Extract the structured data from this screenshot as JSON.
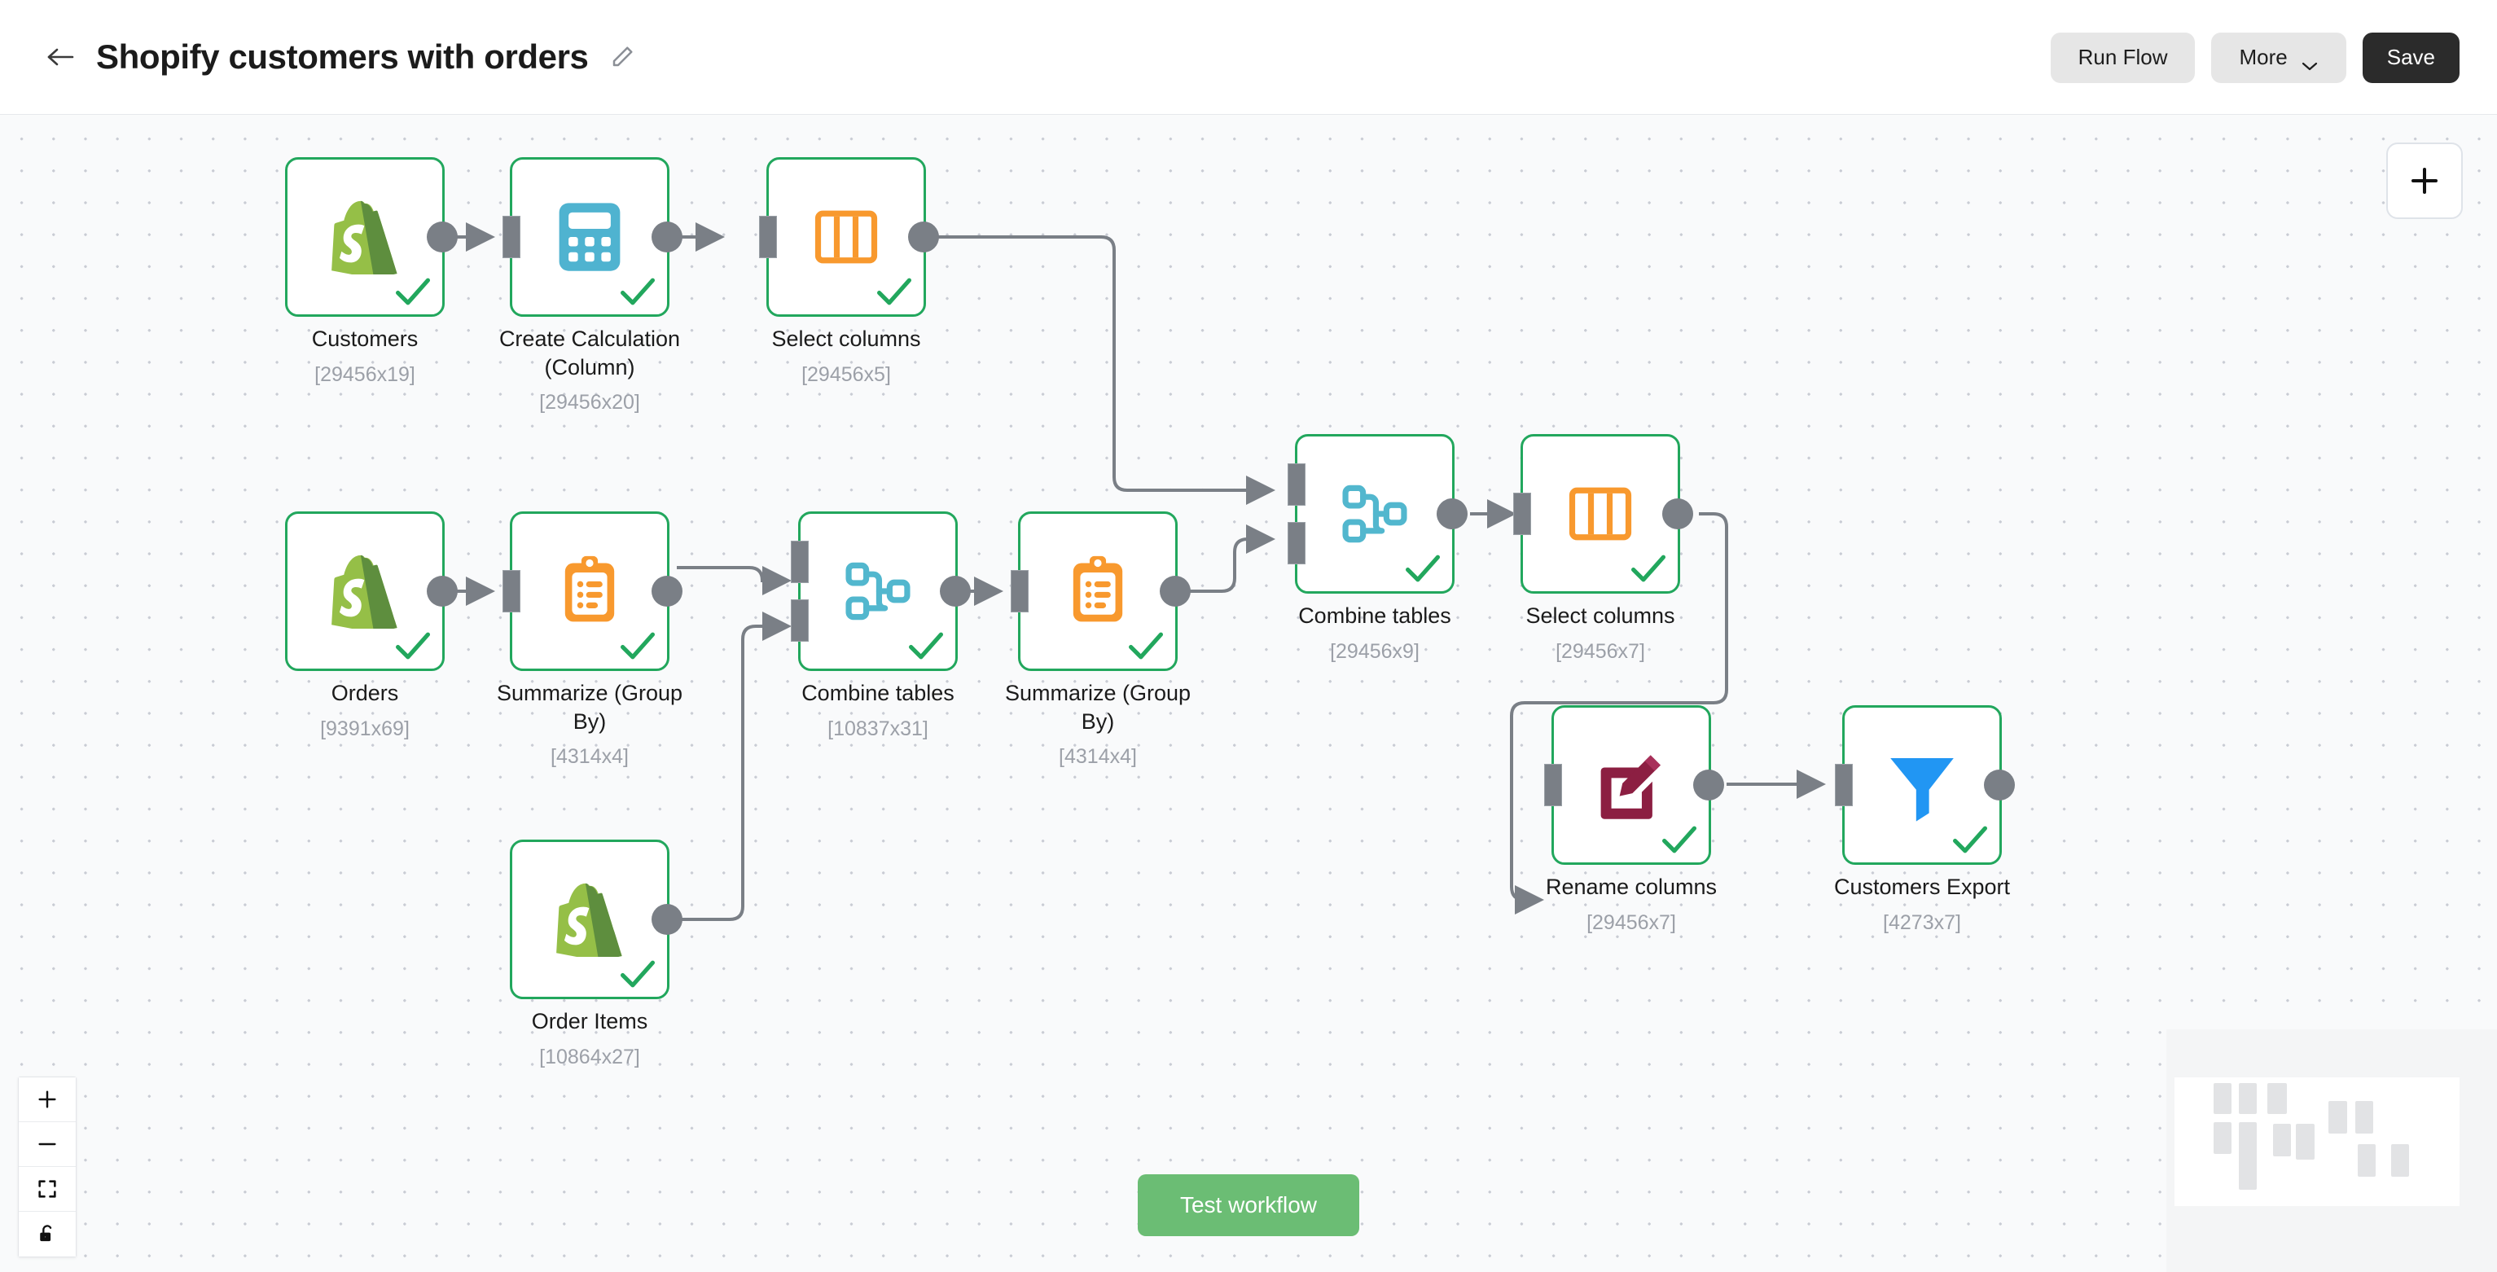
{
  "header": {
    "back_icon": "arrow-left-icon",
    "title": "Shopify customers with orders",
    "edit_icon": "pencil-icon",
    "run_flow_label": "Run Flow",
    "more_label": "More",
    "more_chevron_icon": "chevron-down-icon",
    "save_label": "Save"
  },
  "canvas": {
    "add_node_icon": "plus-icon",
    "test_workflow_label": "Test workflow",
    "zoom_controls": [
      {
        "name": "zoom-in",
        "icon": "plus-icon"
      },
      {
        "name": "zoom-out",
        "icon": "minus-icon"
      },
      {
        "name": "fit-view",
        "icon": "fit-screen-icon"
      },
      {
        "name": "lock-toggle",
        "icon": "unlock-icon"
      }
    ]
  },
  "nodes": [
    {
      "id": "customers",
      "title": "Customers",
      "sub": "[29456x19]",
      "icon": "shopify-icon",
      "status": "success"
    },
    {
      "id": "create-calc",
      "title": "Create Calculation\n(Column)",
      "sub": "[29456x20]",
      "icon": "calculator-icon",
      "status": "success"
    },
    {
      "id": "select-cols-1",
      "title": "Select columns",
      "sub": "[29456x5]",
      "icon": "columns-icon",
      "status": "success"
    },
    {
      "id": "orders",
      "title": "Orders",
      "sub": "[9391x69]",
      "icon": "shopify-icon",
      "status": "success"
    },
    {
      "id": "summarize-1",
      "title": "Summarize (Group\nBy)",
      "sub": "[4314x4]",
      "icon": "clipboard-list-icon",
      "status": "success"
    },
    {
      "id": "combine-2",
      "title": "Combine tables",
      "sub": "[10837x31]",
      "icon": "merge-icon",
      "status": "success"
    },
    {
      "id": "summarize-2",
      "title": "Summarize (Group\nBy)",
      "sub": "[4314x4]",
      "icon": "clipboard-list-icon",
      "status": "success"
    },
    {
      "id": "order-items",
      "title": "Order Items",
      "sub": "[10864x27]",
      "icon": "shopify-icon",
      "status": "success"
    },
    {
      "id": "combine-1",
      "title": "Combine tables",
      "sub": "[29456x9]",
      "icon": "merge-icon",
      "status": "success"
    },
    {
      "id": "select-cols-2",
      "title": "Select columns",
      "sub": "[29456x7]",
      "icon": "columns-icon",
      "status": "success"
    },
    {
      "id": "rename-cols",
      "title": "Rename columns",
      "sub": "[29456x7]",
      "icon": "edit-square-icon",
      "status": "success"
    },
    {
      "id": "customers-export",
      "title": "Customers Export",
      "sub": "[4273x7]",
      "icon": "funnel-icon",
      "status": "success"
    }
  ],
  "colors": {
    "node_border": "#22a75d",
    "check": "#22a75d",
    "edge": "#7a7f86",
    "shopify_green": "#8DB849",
    "calculator_blue": "#4FB3D0",
    "columns_orange": "#F8992E",
    "merge_blue": "#52B7CE",
    "clipboard_orange": "#F8992E",
    "rename_maroon": "#8C1F42",
    "funnel_blue": "#2196F3",
    "test_button_green": "#6bbd74",
    "save_button_dark": "#2b2b2b",
    "canvas_bg": "#f9fafb"
  }
}
